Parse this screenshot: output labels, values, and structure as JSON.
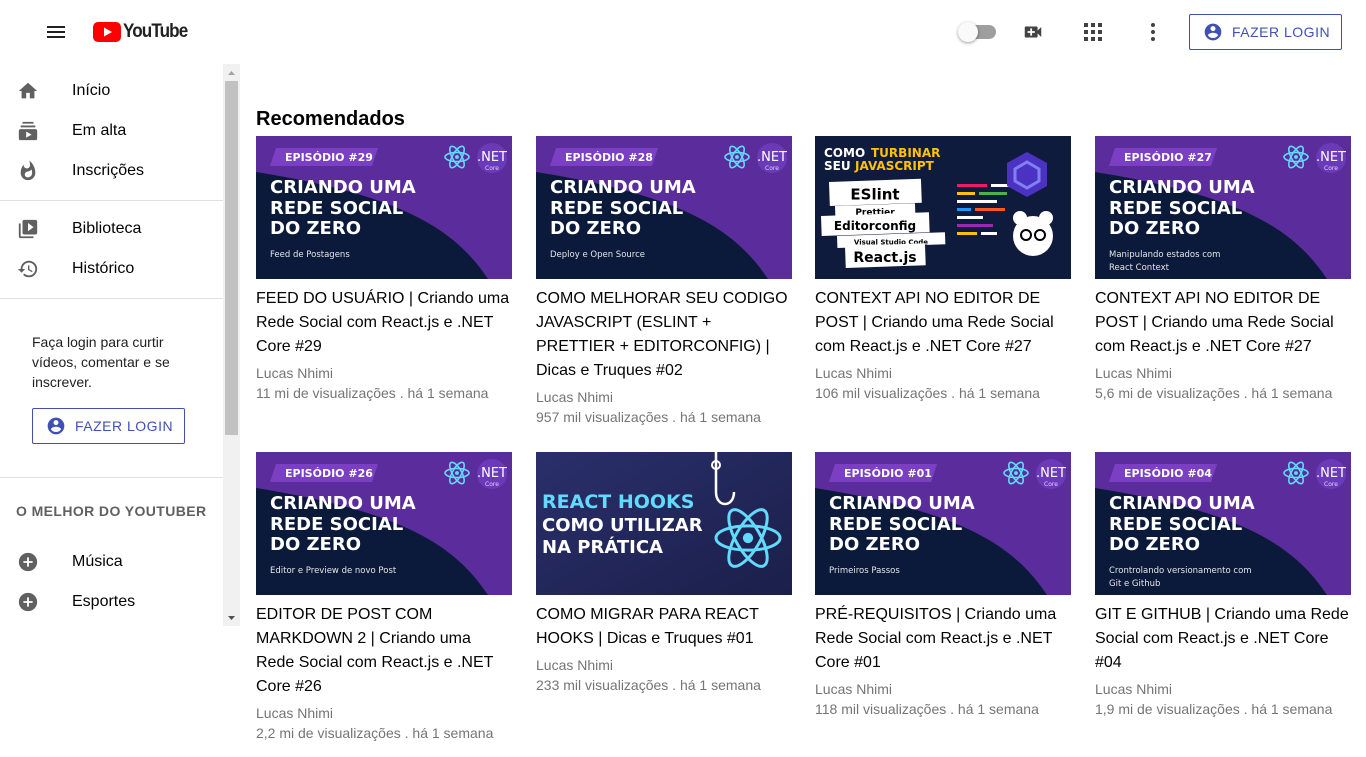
{
  "header": {
    "logo_text": "YouTube",
    "login_label": "FAZER LOGIN",
    "icons": [
      "menu-icon",
      "theme-toggle",
      "video-call-icon",
      "apps-icon",
      "more-vert-icon",
      "account-circle-icon"
    ]
  },
  "sidebar": {
    "items": [
      {
        "label": "Início",
        "icon": "home-icon"
      },
      {
        "label": "Em alta",
        "icon": "subscriptions-icon"
      },
      {
        "label": "Inscrições",
        "icon": "whatshot-icon"
      },
      {
        "label": "Biblioteca",
        "icon": "video-library-icon"
      },
      {
        "label": "Histórico",
        "icon": "history-icon"
      }
    ],
    "login_prompt": "Faça login para curtir vídeos, comentar e se inscrever.",
    "login_label": "FAZER LOGIN",
    "section_title": "O MELHOR DO YOUTUBER",
    "best_items": [
      {
        "label": "Música",
        "icon": "add-circle-icon"
      },
      {
        "label": "Esportes",
        "icon": "add-circle-icon"
      }
    ]
  },
  "main": {
    "section_heading": "Recomendados",
    "videos": [
      {
        "title": "FEED DO USUÁRIO | Criando uma Rede Social com React.js e .NET Core #29",
        "channel": "Lucas Nhimi",
        "meta": "11 mi de visualizações . há 1 semana",
        "thumb": {
          "style": "episode",
          "badge": "EPISÓDIO #29",
          "line1": "CRIANDO UMA",
          "line2": "REDE SOCIAL",
          "line3": "DO ZERO",
          "caption1": "Feed de Postagens",
          "caption2": "",
          "net": ".NET",
          "core": "Core"
        }
      },
      {
        "title": "COMO MELHORAR SEU CODIGO JAVASCRIPT (ESLINT + PRETTIER + EDITORCONFIG) | Dicas e Truques #02",
        "channel": "Lucas Nhimi",
        "meta": "957 mil visualizações . há 1 semana",
        "thumb": {
          "style": "episode",
          "badge": "EPISÓDIO #28",
          "line1": "CRIANDO UMA",
          "line2": "REDE SOCIAL",
          "line3": "DO ZERO",
          "caption1": "Deploy e Open Source",
          "caption2": "",
          "net": ".NET",
          "core": "Core"
        }
      },
      {
        "title": "CONTEXT API NO EDITOR DE POST | Criando uma Rede Social com React.js e .NET Core #27",
        "channel": "Lucas Nhimi",
        "meta": "106 mil visualizações . há 1 semana",
        "thumb": {
          "style": "turbinar",
          "head1": "COMO",
          "head1b": "TURBINAR",
          "head2": "SEU",
          "head2b": "JAVASCRIPT",
          "tag1": "ESlint",
          "tag2": "Prettier",
          "tag3": "Editorconfig",
          "tag4": "Visual Studio Code",
          "tag5": "React.js"
        }
      },
      {
        "title": "CONTEXT API NO EDITOR DE POST | Criando uma Rede Social com React.js e .NET Core #27",
        "channel": "Lucas Nhimi",
        "meta": "5,6 mi de visualizações . há 1 semana",
        "thumb": {
          "style": "episode",
          "badge": "EPISÓDIO #27",
          "line1": "CRIANDO UMA",
          "line2": "REDE SOCIAL",
          "line3": "DO ZERO",
          "caption1": "Manipulando estados com",
          "caption2": "React Context",
          "net": ".NET",
          "core": "Core"
        }
      },
      {
        "title": "EDITOR DE POST COM MARKDOWN 2 | Criando uma Rede Social com React.js e .NET Core #26",
        "channel": "Lucas Nhimi",
        "meta": "2,2 mi de visualizações . há 1 semana",
        "thumb": {
          "style": "episode",
          "badge": "EPISÓDIO #26",
          "line1": "CRIANDO UMA",
          "line2": "REDE SOCIAL",
          "line3": "DO ZERO",
          "caption1": "Editor e Preview de novo Post",
          "caption2": "",
          "net": ".NET",
          "core": "Core"
        }
      },
      {
        "title": "COMO MIGRAR PARA REACT HOOKS | Dicas e Truques #01",
        "channel": "Lucas Nhimi",
        "meta": "233 mil visualizações . há 1 semana",
        "thumb": {
          "style": "hooks",
          "line1": "REACT HOOKS",
          "line2": "COMO UTILIZAR",
          "line3": "NA PRÁTICA"
        }
      },
      {
        "title": "PRÉ-REQUISITOS | Criando uma Rede Social com React.js e .NET Core #01",
        "channel": "Lucas Nhimi",
        "meta": "118 mil visualizações . há 1 semana",
        "thumb": {
          "style": "episode",
          "badge": "EPISÓDIO #01",
          "line1": "CRIANDO UMA",
          "line2": "REDE SOCIAL",
          "line3": "DO ZERO",
          "caption1": "Primeiros Passos",
          "caption2": "",
          "net": ".NET",
          "core": "Core"
        }
      },
      {
        "title": "GIT E GITHUB | Criando uma Rede Social com React.js e .NET Core #04",
        "channel": "Lucas Nhimi",
        "meta": "1,9 mi de visualizações . há 1 semana",
        "thumb": {
          "style": "episode",
          "badge": "EPISÓDIO #04",
          "line1": "CRIANDO UMA",
          "line2": "REDE SOCIAL",
          "line3": "DO ZERO",
          "caption1": "Crontrolando versionamento com",
          "caption2": "Git e Github",
          "net": ".NET",
          "core": "Core"
        }
      }
    ]
  },
  "colors": {
    "accent": "#3f51b5",
    "youtube_red": "#ff0000",
    "thumb_dark": "#0b1a3a",
    "thumb_purple": "#5b2d9c",
    "react_blue": "#61dafb",
    "turbinar_yellow": "#ffc107"
  }
}
